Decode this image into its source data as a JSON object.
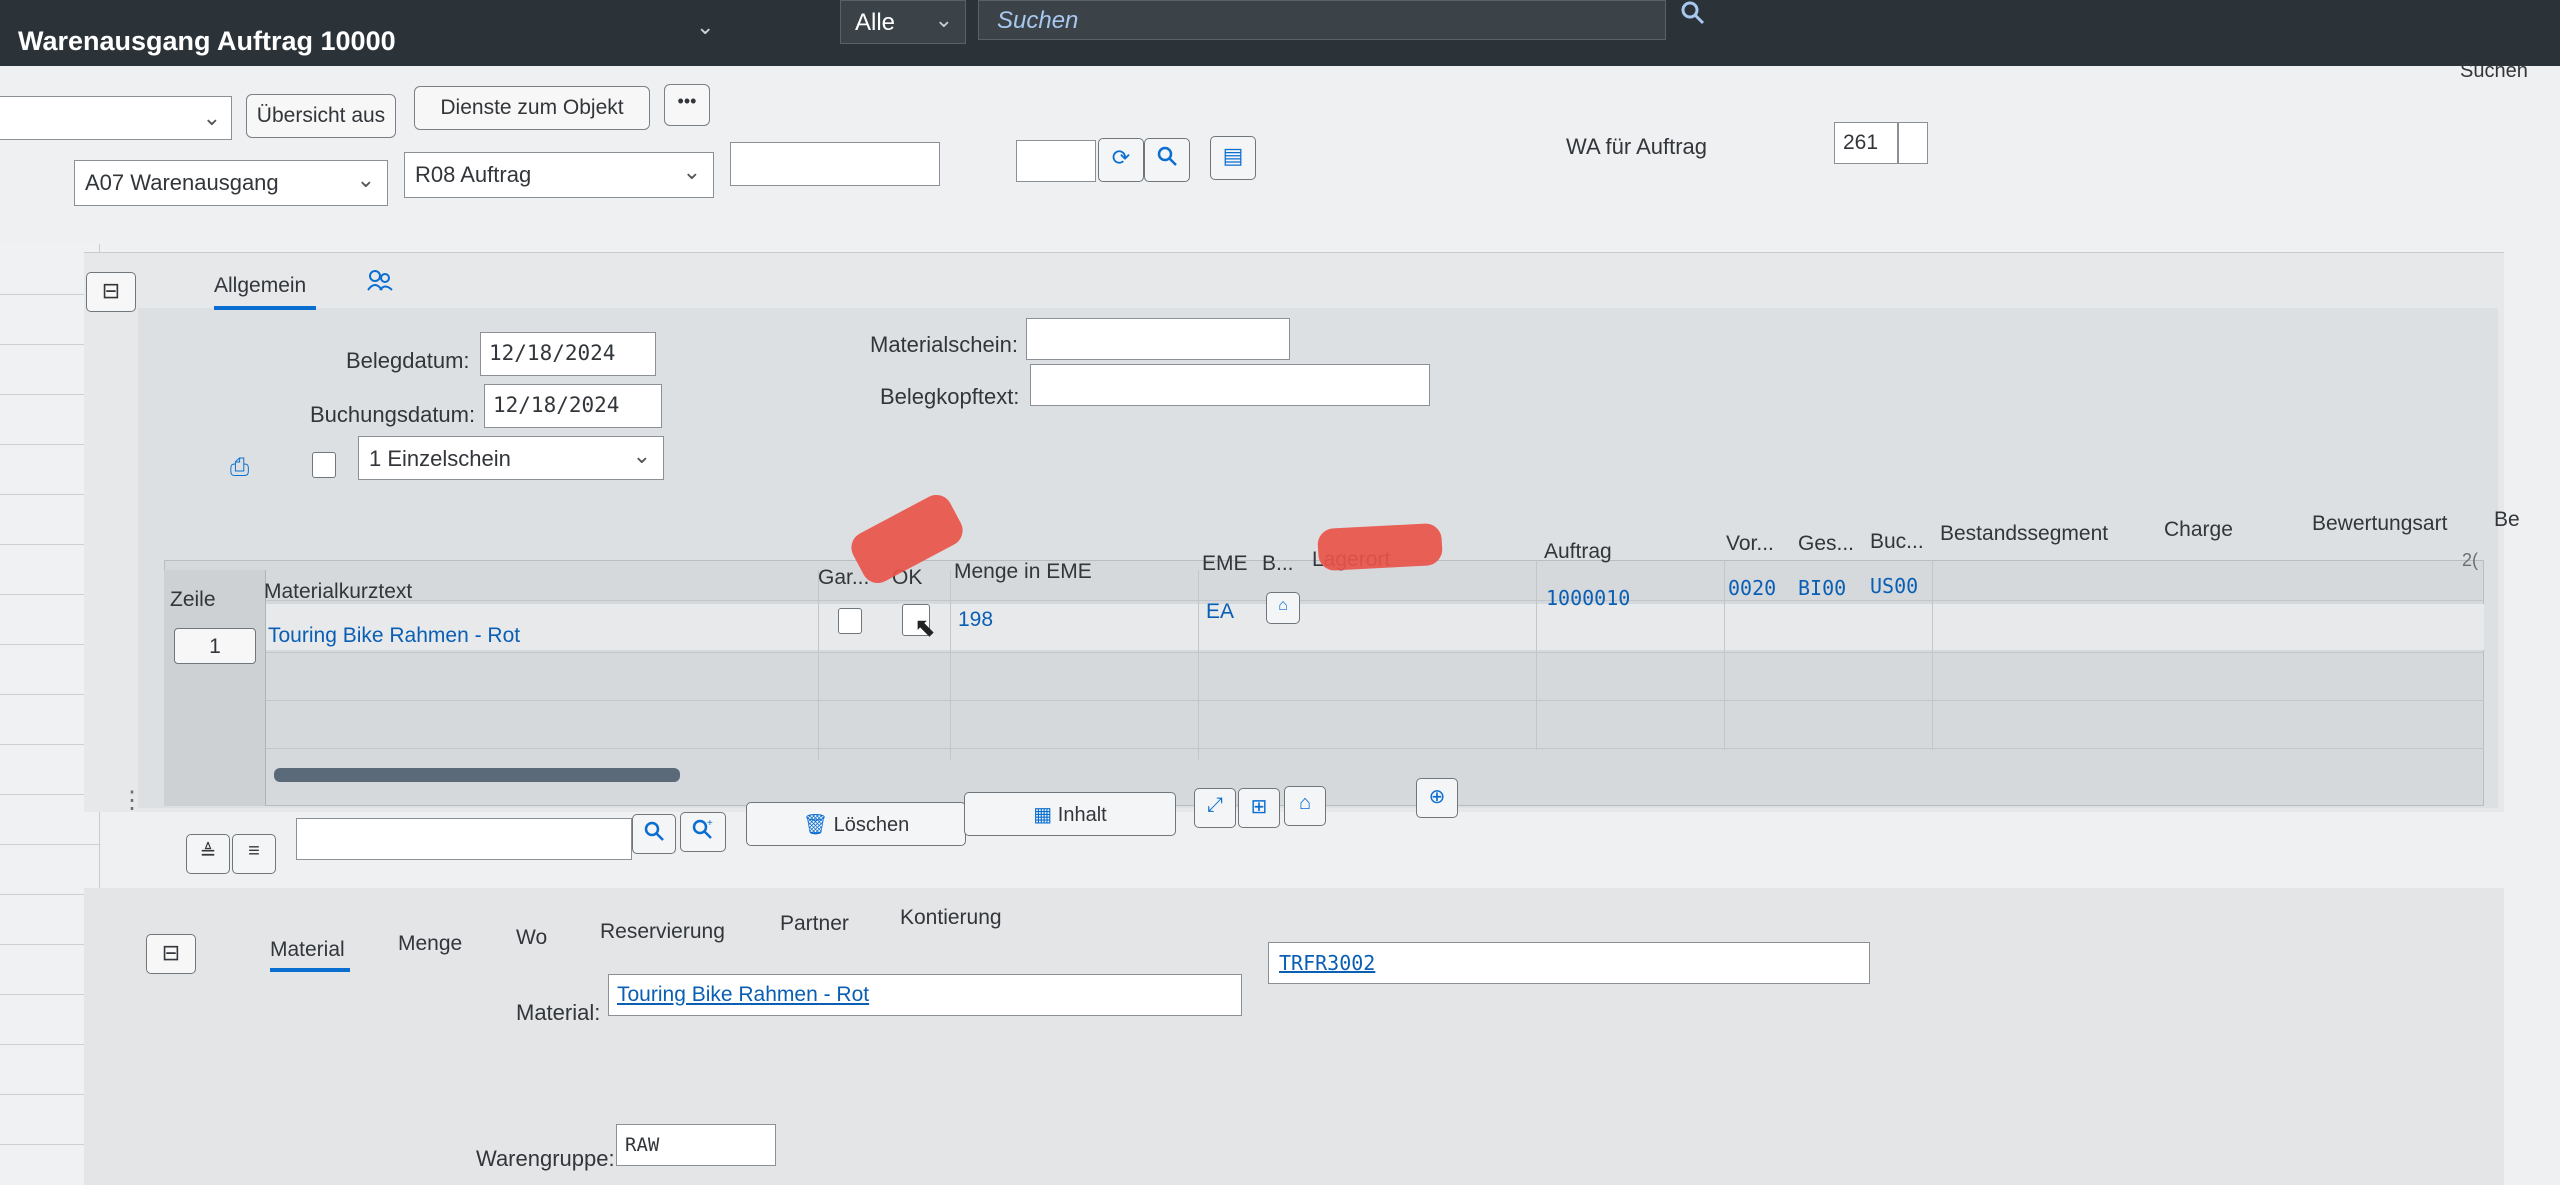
{
  "shell": {
    "title": "Warenausgang Auftrag 10000",
    "scope_dropdown": "Alle",
    "search_placeholder": "Suchen"
  },
  "right_label": "Suchen",
  "toolbar": {
    "uebersicht": "Übersicht aus",
    "dienste": "Dienste zum Objekt",
    "more": "•••"
  },
  "header": {
    "transaction": "A07 Warenausgang",
    "reference": "R08 Auftrag",
    "wa_label": "WA für Auftrag",
    "wa_value": "261"
  },
  "tabs_top": {
    "allgemein": "Allgemein"
  },
  "general": {
    "belegdatum_label": "Belegdatum:",
    "belegdatum_value": "12/18/2024",
    "buchungsdatum_label": "Buchungsdatum:",
    "buchungsdatum_value": "12/18/2024",
    "materialschein_label": "Materialschein:",
    "belegkopftext_label": "Belegkopftext:",
    "druck_value": "1 Einzelschein"
  },
  "table": {
    "headers": {
      "zeile": "Zeile",
      "materialkurztext": "Materialkurztext",
      "gar": "Gar...",
      "ok": "OK",
      "menge": "Menge in EME",
      "eme": "EME",
      "b": "B...",
      "lagerort": "Lagerort",
      "auftrag": "Auftrag",
      "vor": "Vor...",
      "ges": "Ges...",
      "buc": "Buc...",
      "bestandssegment": "Bestandssegment",
      "charge": "Charge",
      "bewertungsart": "Bewertungsart",
      "be": "Be"
    },
    "row": {
      "zeile": "1",
      "materialkurztext": "Touring Bike Rahmen - Rot",
      "menge": "198",
      "eme": "EA",
      "auftrag": "1000010",
      "vor": "0020",
      "ges": "BI00",
      "buc": "US00",
      "extra": "2("
    }
  },
  "table_toolbar": {
    "loeschen": "Löschen",
    "inhalt": "Inhalt"
  },
  "detail": {
    "tabs": [
      "Material",
      "Menge",
      "Wo",
      "Reservierung",
      "Partner",
      "Kontierung"
    ],
    "material_label": "Material:",
    "material_value": "Touring Bike Rahmen - Rot",
    "material_number": "TRFR3002",
    "warengruppe_label": "Warengruppe:",
    "warengruppe_value": "RAW"
  },
  "colors": {
    "shell_bg": "#2c3338",
    "accent": "#0a6ed1",
    "redaction": "#e8544a"
  }
}
